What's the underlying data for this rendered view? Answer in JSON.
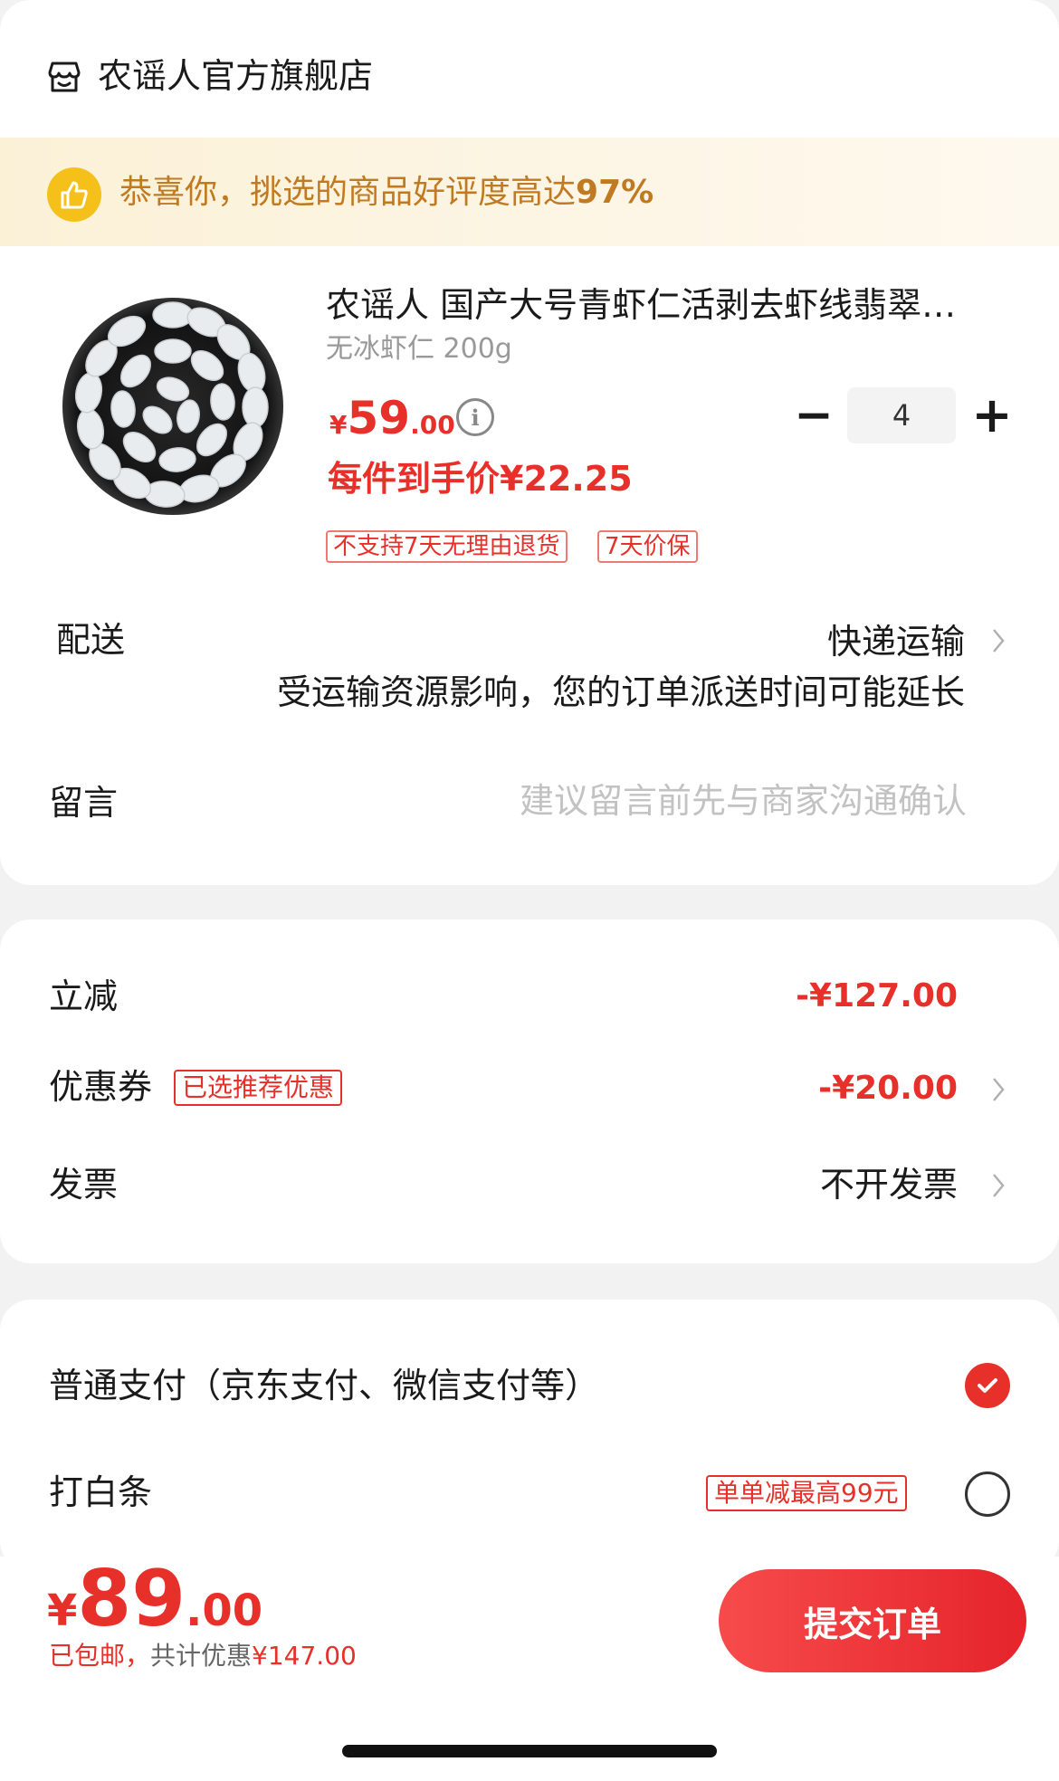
{
  "store": {
    "name": "农谣人官方旗舰店",
    "icon": "store-icon"
  },
  "banner": {
    "text_prefix": "恭喜你，挑选的商品好评度高达",
    "rate": "97%",
    "icon": "thumbs-up-icon"
  },
  "product": {
    "title": "农谣人 国产大号青虾仁活剥去虾线翡翠…",
    "spec": "无冰虾仁 200g",
    "price": {
      "currency": "¥",
      "integer": "59",
      "decimal": ".00"
    },
    "unit_price": "每件到手价¥22.25",
    "tags": [
      "不支持7天无理由退货",
      "7天价保"
    ],
    "quantity": "4",
    "minus": "−",
    "plus": "+"
  },
  "shipping": {
    "label": "配送",
    "value": "快递运输",
    "note": "受运输资源影响，您的订单派送时间可能延长"
  },
  "message": {
    "label": "留言",
    "placeholder": "建议留言前先与商家沟通确认"
  },
  "discounts": {
    "instant": {
      "label": "立减",
      "value": "-¥127.00"
    },
    "coupon": {
      "label": "优惠券",
      "tag": "已选推荐优惠",
      "value": "-¥20.00"
    },
    "invoice": {
      "label": "发票",
      "value": "不开发票"
    }
  },
  "payment": {
    "options": [
      {
        "label": "普通支付（京东支付、微信支付等）",
        "selected": true
      },
      {
        "label": "打白条",
        "tag": "单单减最高99元",
        "selected": false
      }
    ]
  },
  "footer": {
    "total": {
      "currency": "¥",
      "integer": "89",
      "decimal": ".00"
    },
    "note_shipping": "已包邮，",
    "note_saving_label": "共计优惠",
    "note_saving_value": "¥147.00",
    "submit_label": "提交订单"
  },
  "colors": {
    "accent": "#e8302a",
    "banner_text": "#c07a22",
    "banner_bg": "#fbf1d7"
  }
}
